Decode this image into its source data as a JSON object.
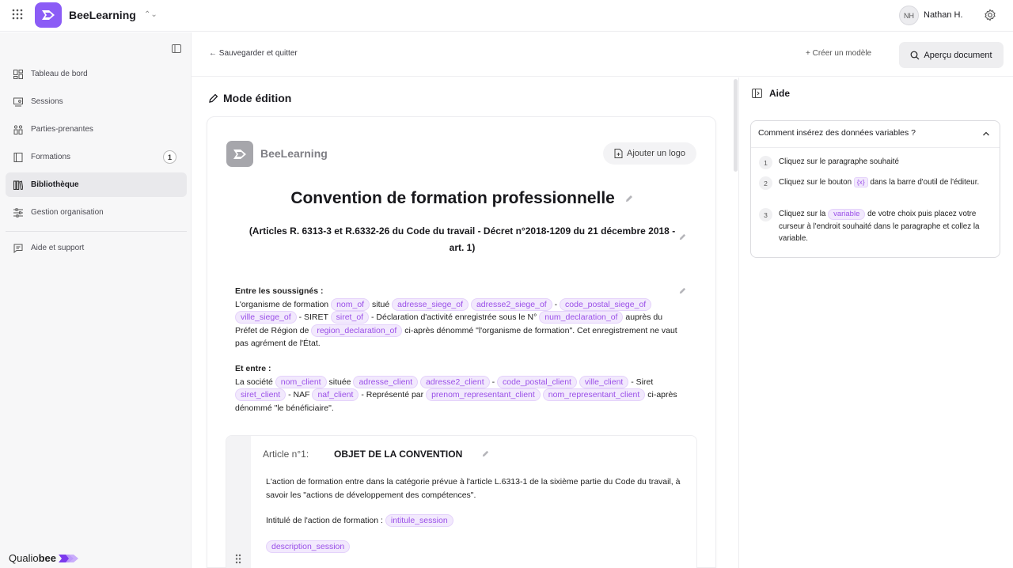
{
  "app": {
    "name": "BeeLearning",
    "user_initials": "NH",
    "user_name": "Nathan H."
  },
  "sidebar": {
    "items": [
      {
        "label": "Tableau de bord",
        "icon": "dashboard-icon"
      },
      {
        "label": "Sessions",
        "icon": "sessions-icon"
      },
      {
        "label": "Parties-prenantes",
        "icon": "stakeholders-icon"
      },
      {
        "label": "Formations",
        "icon": "book-icon",
        "badge": "1"
      },
      {
        "label": "Bibliothèque",
        "icon": "library-icon",
        "active": true
      },
      {
        "label": "Gestion organisation",
        "icon": "sliders-icon"
      },
      {
        "label": "Aide et support",
        "icon": "chat-icon"
      }
    ],
    "footer_brand_prefix": "Qualio",
    "footer_brand_suffix": "bee"
  },
  "header": {
    "back_label": "← Sauvegarder et quitter",
    "create_model_label": "+ Créer un modèle",
    "preview_label": "Aperçu document"
  },
  "editor": {
    "mode_title": "Mode édition",
    "doc_brand": "BeeLearning",
    "add_logo_label": "Ajouter un logo",
    "doc_title": "Convention de formation professionnelle",
    "doc_subtitle": "(Articles R. 6313-3 et R.6332-26 du Code du travail - Décret n°2018-1209 du 21 décembre 2018 - art. 1)",
    "parties_heading": "Entre les soussignés :",
    "p1": {
      "t1": "L'organisme de formation",
      "t2": "situé",
      "t3": "-",
      "t4": "- SIRET",
      "t5": "- Déclaration d'activité enregistrée sous le N°",
      "t6": "auprès du Préfet de Région de",
      "t7": "ci-après dénommé \"l'organisme de formation\". Cet enregistrement ne vaut pas agrément de l'État."
    },
    "client_heading": "Et entre :",
    "p2": {
      "t1": "La société",
      "t2": "située",
      "t3": "-",
      "t4": "- Siret",
      "t5": "- NAF",
      "t6": "- Représenté par",
      "t7": "ci-après dénommé \"le bénéficiaire\"."
    },
    "vars": {
      "nom_of": "nom_of",
      "adresse_siege_of": "adresse_siege_of",
      "adresse2_siege_of": "adresse2_siege_of",
      "code_postal_siege_of": "code_postal_siege_of",
      "ville_siege_of": "ville_siege_of",
      "siret_of": "siret_of",
      "num_declaration_of": "num_declaration_of",
      "region_declaration_of": "region_declaration_of",
      "nom_client": "nom_client",
      "adresse_client": "adresse_client",
      "adresse2_client": "adresse2_client",
      "code_postal_client": "code_postal_client",
      "ville_client": "ville_client",
      "siret_client": "siret_client",
      "naf_client": "naf_client",
      "prenom_representant_client": "prenom_representant_client",
      "nom_representant_client": "nom_representant_client",
      "intitule_session": "intitule_session",
      "description_session": "description_session"
    },
    "article": {
      "number": "Article n°1:",
      "title": "OBJET DE LA CONVENTION",
      "text": "L'action de formation entre dans la catégorie prévue à l'article L.6313-1 de la sixième partie du Code du travail, à savoir les \"actions de développement des compétences\".",
      "intitule_label": "Intitulé de l'action de formation :"
    }
  },
  "help": {
    "title": "Aide",
    "question": "Comment insérez des données variables ?",
    "steps": [
      {
        "num": "1",
        "text": "Cliquez sur le paragraphe souhaité"
      },
      {
        "num": "2",
        "before": "Cliquez sur le bouton",
        "chip": "{x}",
        "after": "dans la barre d'outil de l'éditeur."
      },
      {
        "num": "3",
        "before": "Cliquez sur la",
        "chip": "variable",
        "after": "de votre choix puis placez votre curseur à l'endroit souhaité dans le paragraphe et collez la variable."
      }
    ]
  },
  "colors": {
    "accent": "#8b5cf6",
    "variable_text": "#9a4fe8",
    "variable_bg": "#f2e9fd"
  }
}
